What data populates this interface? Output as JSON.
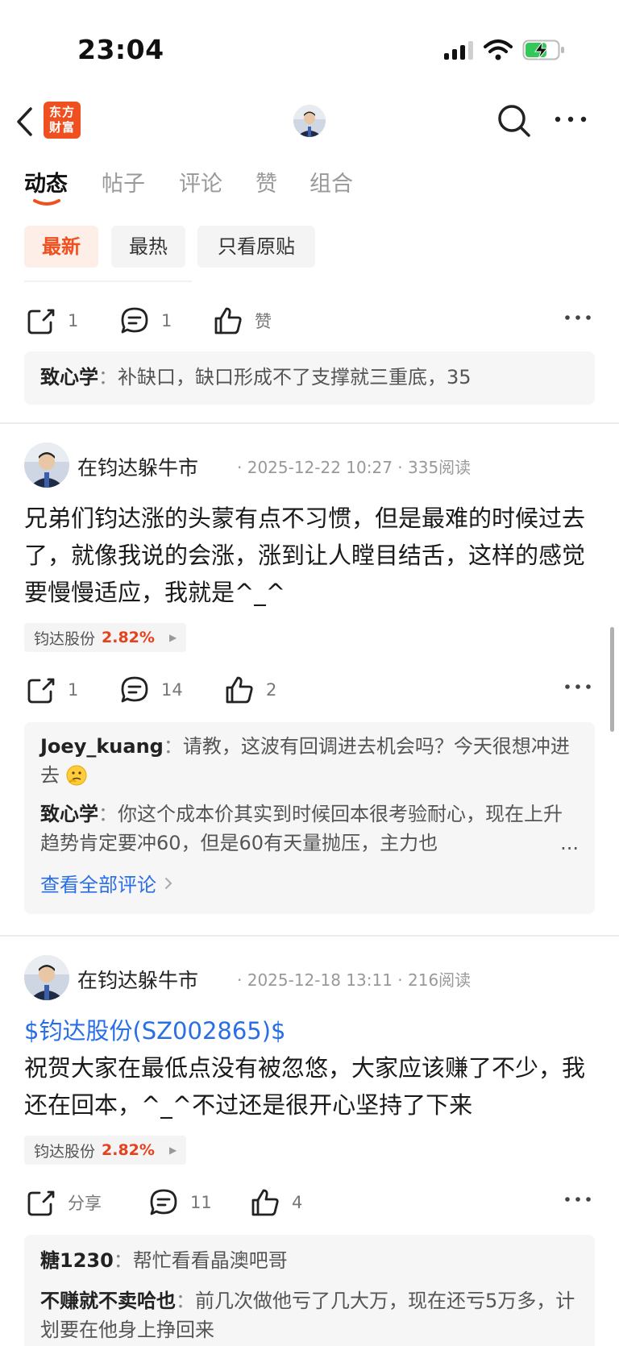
{
  "status_bar": {
    "time": "23:04"
  },
  "nav": {
    "brand_logo_text": "东方财富"
  },
  "tabs": [
    "动态",
    "帖子",
    "评论",
    "赞",
    "组合"
  ],
  "filters": [
    "最新",
    "最热",
    "只看原贴"
  ],
  "colors": {
    "accent": "#f0501f",
    "link": "#2a6ee6",
    "rise": "#e6411d"
  },
  "top_fragment": {
    "share_count": "1",
    "comment_count": "1",
    "like_label": "赞",
    "reply": {
      "user": "致心学",
      "sep": "：",
      "text": "补缺口，缺口形成不了支撑就三重底，35"
    }
  },
  "posts": [
    {
      "author": "在钧达躲牛市",
      "meta": "· 2025-12-22 10:27 · 335阅读",
      "body": "兄弟们钧达涨的头蒙有点不习惯，但是最难的时候过去了，就像我说的会涨，涨到让人瞠目结舌，这样的感觉要慢慢适应，我就是^_^",
      "stock": {
        "name": "钧达股份",
        "pct": "2.82%"
      },
      "share": "1",
      "comments": "14",
      "likes": "2",
      "replies": [
        {
          "user": "Joey_kuang",
          "sep": "：",
          "text": "请教，这波有回调进去机会吗？今天很想冲进去",
          "emoji": "thinking-emoji"
        },
        {
          "user": "致心学",
          "sep": "：",
          "text": "你这个成本价其实到时候回本很考验耐心，现在上升趋势肯定要冲60，但是60有天量抛压，主力也",
          "ellipsis": "..."
        }
      ],
      "view_all": "查看全部评论"
    },
    {
      "author": "在钧达躲牛市",
      "meta": "· 2025-12-18 13:11 · 216阅读",
      "link": "$钧达股份(SZ002865)$",
      "body": "祝贺大家在最低点没有被忽悠，大家应该赚了不少，我还在回本，^_^不过还是很开心坚持了下来",
      "stock": {
        "name": "钧达股份",
        "pct": "2.82%"
      },
      "share": "分享",
      "comments": "11",
      "likes": "4",
      "replies": [
        {
          "user": "糖1230",
          "sep": "：",
          "text": "帮忙看看晶澳吧哥"
        },
        {
          "user": "不赚就不卖哈也",
          "sep": "：",
          "text": "前几次做他亏了几大万，现在还亏5万多，计划要在他身上挣回来"
        }
      ]
    }
  ]
}
